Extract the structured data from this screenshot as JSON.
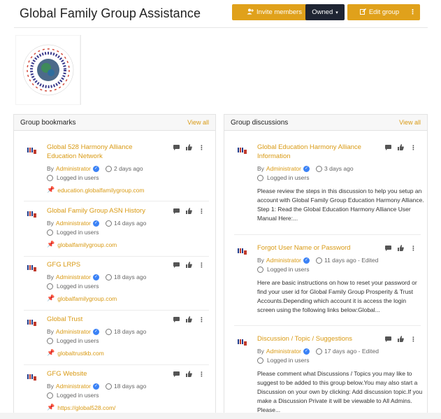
{
  "header": {
    "title": "Global Family Group Assistance",
    "invite_label": "Invite members",
    "owned_label": "Owned",
    "edit_label": "Edit group"
  },
  "bookmarks": {
    "title": "Group bookmarks",
    "view_all": "View all",
    "items": [
      {
        "title": "Global 528 Harmony Alliance Education Network",
        "author": "Administrator",
        "time": "2 days ago",
        "access": "Logged in users",
        "link": "education.globalfamilygroup.com"
      },
      {
        "title": "Global Family Group ASN History",
        "author": "Administrator",
        "time": "14 days ago",
        "access": "Logged in users",
        "link": "globalfamilygroup.com"
      },
      {
        "title": "GFG LRPS",
        "author": "Administrator",
        "time": "18 days ago",
        "access": "Logged in users",
        "link": "globalfamilygroup.com"
      },
      {
        "title": "Global Trust",
        "author": "Administrator",
        "time": "18 days ago",
        "access": "Logged in users",
        "link": "globaltrustkb.com"
      },
      {
        "title": "GFG Website",
        "author": "Administrator",
        "time": "18 days ago",
        "access": "Logged in users",
        "link": "https://global528.com/"
      }
    ]
  },
  "discussions": {
    "title": "Group discussions",
    "view_all": "View all",
    "items": [
      {
        "title": "Global Education Harmony Alliance Information",
        "author": "Administrator",
        "time": "3 days ago",
        "access": "Logged in users",
        "body": "Please review the steps in this discussion to help you setup an account with Global Family Group Education Harmony Alliance.  Step 1: Read the Global Education Harmony Alliance User Manual Here:..."
      },
      {
        "title": "Forgot User Name or Password",
        "author": "Administrator",
        "time": "11 days ago - Edited",
        "access": "Logged in users",
        "body": "Here are basic instructions on how to reset your password or find your user id for Global Family Group Prosperity & Trust Accounts.Depending which account it is access the login screen using the following links below:Global..."
      },
      {
        "title": "Discussion / Topic / Suggestions",
        "author": "Administrator",
        "time": "17 days ago - Edited",
        "access": "Logged in users",
        "body": "Please comment what Discussions / Topics you may like to suggest to be added to this group below.You may also start a Discussion on your own by clicking: Add discussion topic.If you make a Discussion Private it will be viewable to All Admins. Please..."
      }
    ]
  },
  "common": {
    "by": "By"
  },
  "colors": {
    "accent": "#e0a11b",
    "dark_button": "#1f2533",
    "link": "#d99a14"
  }
}
